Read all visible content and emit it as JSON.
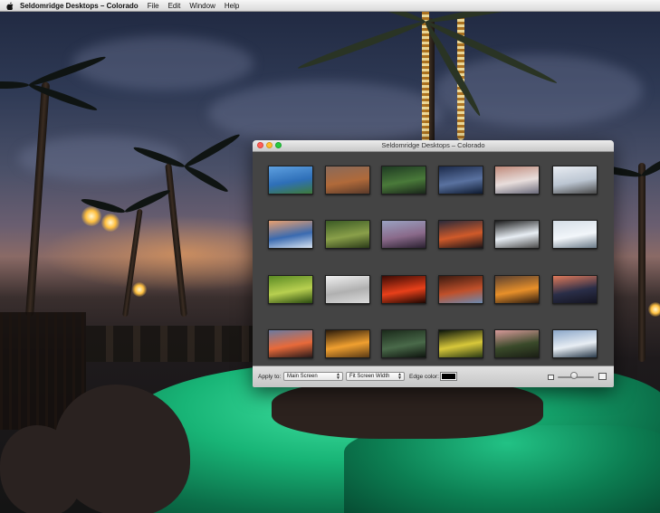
{
  "menubar": {
    "app_name": "Seldomridge Desktops – Colorado",
    "menus": [
      "File",
      "Edit",
      "Window",
      "Help"
    ]
  },
  "window": {
    "title": "Seldomridge Desktops – Colorado"
  },
  "thumbnails": [
    {
      "name": "lake-blue-sky",
      "colors": [
        "#5ea0e0",
        "#2e6fb8",
        "#3e7a3a"
      ]
    },
    {
      "name": "red-canyon",
      "colors": [
        "#8a6a5a",
        "#b06a3a",
        "#5a3a2a"
      ]
    },
    {
      "name": "forest-stream",
      "colors": [
        "#1e3a22",
        "#4a7a3a",
        "#1a261a"
      ]
    },
    {
      "name": "stormy-sky",
      "colors": [
        "#1c2a4a",
        "#5a72a0",
        "#0e1a30"
      ]
    },
    {
      "name": "snowy-ridge",
      "colors": [
        "#c08a7a",
        "#e8dedc",
        "#6a6a7a"
      ]
    },
    {
      "name": "fog-island",
      "colors": [
        "#e8ecf2",
        "#bcc6d2",
        "#4a4a4a"
      ]
    },
    {
      "name": "dusk-snow-peaks",
      "colors": [
        "#e8a070",
        "#3a6ab0",
        "#d8e4f2"
      ]
    },
    {
      "name": "green-hills",
      "colors": [
        "#3a5a24",
        "#8aa04a",
        "#2a3a18"
      ]
    },
    {
      "name": "purple-dusk",
      "colors": [
        "#9aa2c2",
        "#8a6a8a",
        "#2a2030"
      ]
    },
    {
      "name": "orange-sunset-valley",
      "colors": [
        "#2a2a3a",
        "#d05a2a",
        "#1a1418"
      ]
    },
    {
      "name": "snow-branch",
      "colors": [
        "#1a1a1a",
        "#e8eef4",
        "#4a4a4a"
      ]
    },
    {
      "name": "frosted-twig",
      "colors": [
        "#d4dde6",
        "#f2f6fa",
        "#6a7a88"
      ]
    },
    {
      "name": "green-leaf",
      "colors": [
        "#5a8a24",
        "#b8d050",
        "#2a4a10"
      ]
    },
    {
      "name": "white-drifts",
      "colors": [
        "#f0f0f0",
        "#b0b0b0",
        "#dcdcdc"
      ]
    },
    {
      "name": "glowing-embers",
      "colors": [
        "#3a0a04",
        "#e8401a",
        "#1a0602"
      ]
    },
    {
      "name": "red-rock-vista",
      "colors": [
        "#3a1a10",
        "#c0502a",
        "#6a8ab0"
      ]
    },
    {
      "name": "amber-horizon",
      "colors": [
        "#5a4030",
        "#e8902a",
        "#2a1a10"
      ]
    },
    {
      "name": "sunset-ridge",
      "colors": [
        "#e07a5a",
        "#2a2e48",
        "#141420"
      ]
    },
    {
      "name": "sunset-trees",
      "colors": [
        "#6a7aa0",
        "#e86a3a",
        "#2a1a1a"
      ]
    },
    {
      "name": "golden-path",
      "colors": [
        "#2a1a0a",
        "#f0a030",
        "#5a3a14"
      ]
    },
    {
      "name": "forest-pond",
      "colors": [
        "#1a2a1a",
        "#4a6a4a",
        "#0e140e"
      ]
    },
    {
      "name": "aspen-leaves",
      "colors": [
        "#0a140a",
        "#d8c83a",
        "#2a3a14"
      ]
    },
    {
      "name": "pink-valley",
      "colors": [
        "#d89a9a",
        "#3a4a2a",
        "#1a1e14"
      ]
    },
    {
      "name": "mountain-clouds",
      "colors": [
        "#8aa6c8",
        "#e8eef4",
        "#2a3a4a"
      ]
    }
  ],
  "toolbar": {
    "apply_label": "Apply to:",
    "screen_value": "Main Screen",
    "fit_value": "Fit Screen Width",
    "edge_label": "Edge color:",
    "edge_color": "#000000",
    "size_slider_fraction": 0.45
  }
}
